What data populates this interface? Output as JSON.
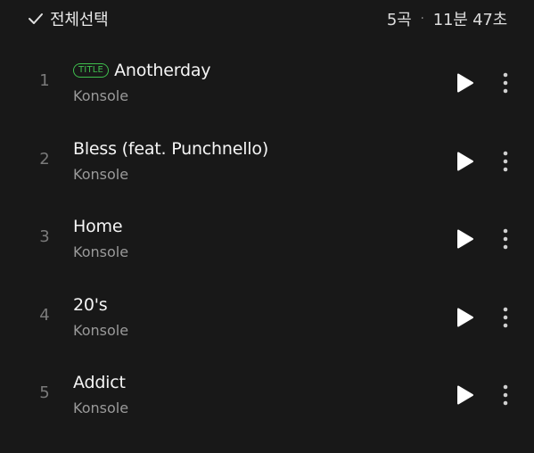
{
  "header": {
    "select_all_label": "전체선택",
    "track_count": "5곡",
    "separator": "·",
    "total_duration": "11분 47초"
  },
  "badge_label": "TITLE",
  "tracks": [
    {
      "number": "1",
      "title": "Anotherday",
      "artist": "Konsole",
      "is_title": true
    },
    {
      "number": "2",
      "title": "Bless (feat. Punchnello)",
      "artist": "Konsole",
      "is_title": false
    },
    {
      "number": "3",
      "title": "Home",
      "artist": "Konsole",
      "is_title": false
    },
    {
      "number": "4",
      "title": "20's",
      "artist": "Konsole",
      "is_title": false
    },
    {
      "number": "5",
      "title": "Addict",
      "artist": "Konsole",
      "is_title": false
    }
  ],
  "icons": {
    "select": "check-icon",
    "play": "play-icon",
    "more": "more-vertical-icon"
  },
  "colors": {
    "background": "#181818",
    "accent_green": "#3fbf4e",
    "secondary_text": "#9a9a9a"
  }
}
